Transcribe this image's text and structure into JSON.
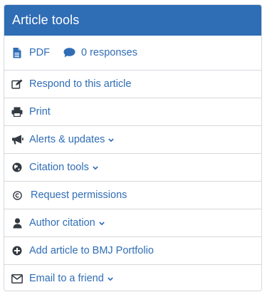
{
  "panel": {
    "title": "Article tools"
  },
  "links": {
    "pdf": "PDF",
    "responses": "0 responses"
  },
  "items": [
    {
      "label": "Respond to this article",
      "icon": "edit-icon",
      "dropdown": false
    },
    {
      "label": "Print",
      "icon": "print-icon",
      "dropdown": false
    },
    {
      "label": "Alerts & updates",
      "icon": "megaphone-icon",
      "dropdown": true
    },
    {
      "label": "Citation tools",
      "icon": "globe-icon",
      "dropdown": true
    },
    {
      "label": "Request permissions",
      "icon": "copyright-icon",
      "dropdown": false
    },
    {
      "label": "Author citation",
      "icon": "user-icon",
      "dropdown": true
    },
    {
      "label": "Add article to BMJ Portfolio",
      "icon": "plus-circle-icon",
      "dropdown": false
    },
    {
      "label": "Email to a friend",
      "icon": "envelope-icon",
      "dropdown": true
    }
  ],
  "colors": {
    "header": "#2f6db5",
    "link": "#2f6db5",
    "icon": "#333a41",
    "border": "#d5d9dd"
  }
}
